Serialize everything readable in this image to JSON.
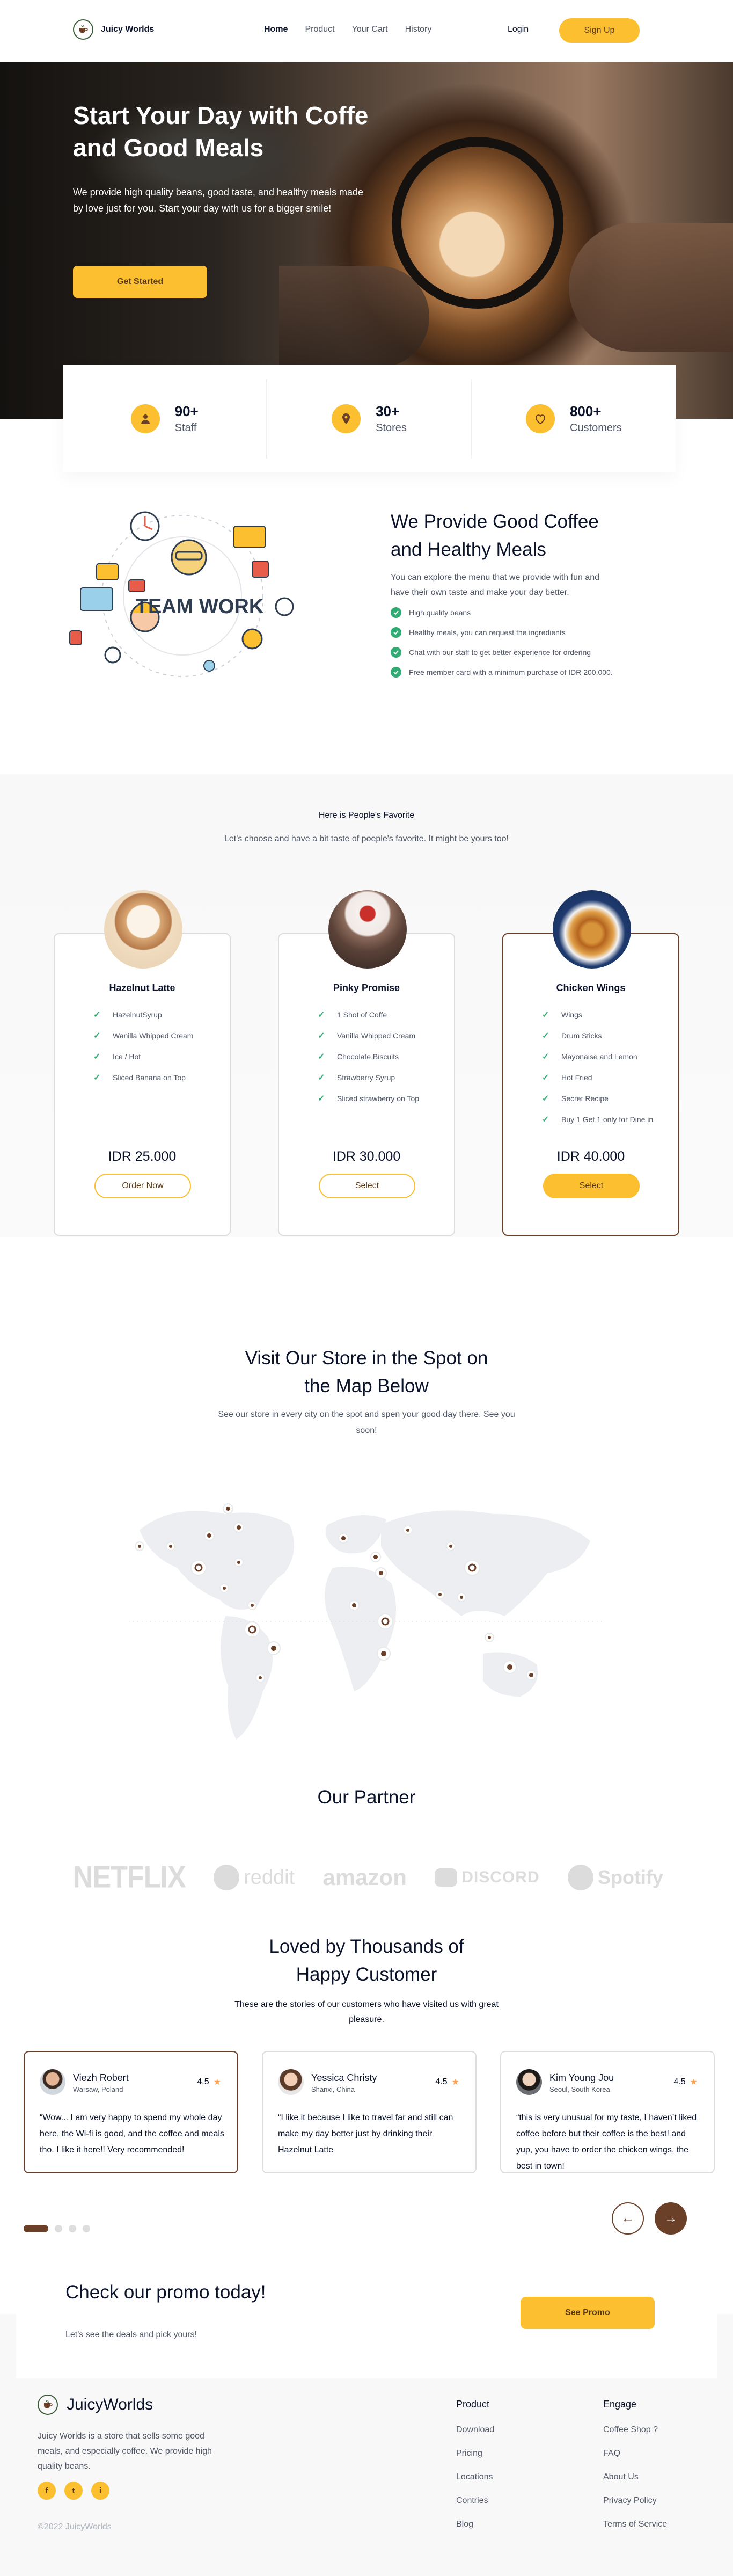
{
  "nav": {
    "brand": "Juicy Worlds",
    "menu": [
      "Home",
      "Product",
      "Your Cart",
      "History"
    ],
    "login": "Login",
    "signup": "Sign Up"
  },
  "hero": {
    "title": "Start Your Day with Coffe and Good Meals",
    "desc": "We provide high quality beans, good taste, and healthy meals made by love just for you. Start your day with us for a bigger smile!",
    "cta": "Get Started"
  },
  "stats": [
    {
      "num": "90+",
      "label": "Staff",
      "icon": "user-icon"
    },
    {
      "num": "30+",
      "label": "Stores",
      "icon": "location-pin-icon"
    },
    {
      "num": "800+",
      "label": "Customers",
      "icon": "heart-icon"
    }
  ],
  "about": {
    "art_label": "TEAM WORK",
    "title": "We Provide Good Coffee and Healthy Meals",
    "desc": "You can explore the menu that we provide with fun and have their own taste and make your day better.",
    "points": [
      "High quality beans",
      "Healthy meals, you can request the ingredients",
      "Chat with our staff to get better experience for ordering",
      "Free member card with a minimum purchase of IDR 200.000."
    ]
  },
  "favorites": {
    "title": "Here is People's Favorite",
    "subtitle": "Let's choose and have a bit taste of poeple's favorite. It might be yours too!",
    "items": [
      {
        "name": "Hazelnut Latte",
        "features": [
          "HazelnutSyrup",
          "Wanilla Whipped Cream",
          "Ice / Hot",
          "Sliced Banana on Top"
        ],
        "price": "IDR 25.000",
        "button": "Order Now"
      },
      {
        "name": "Pinky Promise",
        "features": [
          "1 Shot of Coffe",
          "Vanilla Whipped Cream",
          "Chocolate Biscuits",
          "Strawberry Syrup",
          "Sliced strawberry on Top"
        ],
        "price": "IDR 30.000",
        "button": "Select"
      },
      {
        "name": "Chicken Wings",
        "features": [
          "Wings",
          "Drum Sticks",
          "Mayonaise and Lemon",
          "Hot Fried",
          "Secret Recipe",
          "Buy 1 Get 1 only for Dine in"
        ],
        "price": "IDR 40.000",
        "button": "Select"
      }
    ]
  },
  "map": {
    "title": "Visit Our Store in the Spot on the Map Below",
    "desc": "See our store in every city on the spot and spen your good day there. See you soon!"
  },
  "partners": {
    "title": "Our Partner",
    "names": [
      "NETFLIX",
      "reddit",
      "amazon",
      "DISCORD",
      "Spotify"
    ]
  },
  "testimonials": {
    "title": "Loved by Thousands of Happy Customer",
    "desc": "These are the stories of our customers who have visited us with great pleasure.",
    "items": [
      {
        "name": "Viezh Robert",
        "location": "Warsaw, Poland",
        "rating": "4.5",
        "text": "“Wow... I am very happy to spend my whole day here. the Wi-fi is good, and the coffee and meals tho. I like it here!! Very recommended!"
      },
      {
        "name": "Yessica Christy",
        "location": "Shanxi, China",
        "rating": "4.5",
        "text": "“I like it because I like to travel far and still can make my day better just by drinking their Hazelnut Latte"
      },
      {
        "name": "Kim Young Jou",
        "location": "Seoul, South Korea",
        "rating": "4.5",
        "text": "“this is very unusual for my taste, I haven’t liked coffee before but their coffee is the best! and yup, you have to order the chicken wings, the best in town!"
      }
    ]
  },
  "promo": {
    "title": "Check our promo today!",
    "subtitle": "Let's see the deals and pick yours!",
    "button": "See Promo"
  },
  "footer": {
    "brand": "JuicyWorlds",
    "desc": "Juicy Worlds is a store that sells some good meals, and especially coffee. We provide high quality beans.",
    "social": [
      "f",
      "t",
      "i"
    ],
    "copyright": "©2022 JuicyWorlds",
    "col1": {
      "title": "Product",
      "links": [
        "Download",
        "Pricing",
        "Locations",
        "Contries",
        "Blog"
      ]
    },
    "col2": {
      "title": "Engage",
      "links": [
        "Coffee Shop ?",
        "FAQ",
        "About Us",
        "Privacy Policy",
        "Terms of Service"
      ]
    }
  },
  "colors": {
    "accent": "#fbbf2f",
    "brown": "#6a4029",
    "green": "#2fab73",
    "text": "#0b132a"
  }
}
